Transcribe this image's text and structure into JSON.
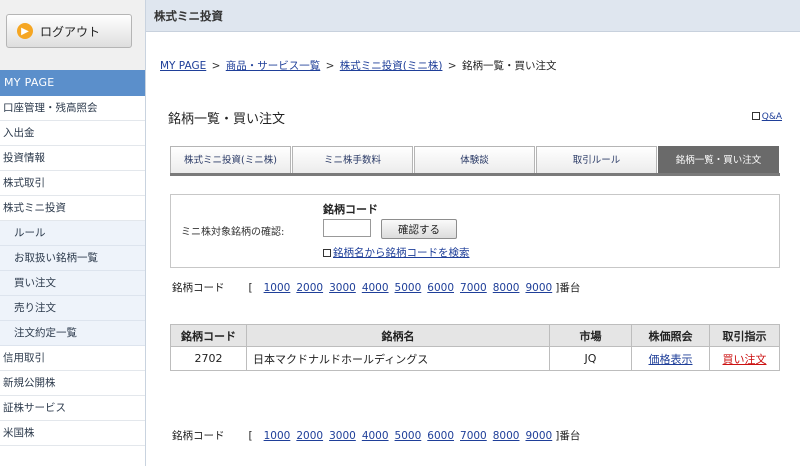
{
  "sidebar": {
    "logout_label": "ログアウト",
    "mypage_label": "MY PAGE",
    "items": [
      {
        "label": "口座管理・残高照会",
        "sub": false
      },
      {
        "label": "入出金",
        "sub": false
      },
      {
        "label": "投資情報",
        "sub": false
      },
      {
        "label": "株式取引",
        "sub": false
      },
      {
        "label": "株式ミニ投資",
        "sub": false
      },
      {
        "label": "ルール",
        "sub": true
      },
      {
        "label": "お取扱い銘柄一覧",
        "sub": true
      },
      {
        "label": "買い注文",
        "sub": true
      },
      {
        "label": "売り注文",
        "sub": true
      },
      {
        "label": "注文約定一覧",
        "sub": true
      },
      {
        "label": "信用取引",
        "sub": false
      },
      {
        "label": "新規公開株",
        "sub": false
      },
      {
        "label": "証株サービス",
        "sub": false
      },
      {
        "label": "米国株",
        "sub": false
      }
    ]
  },
  "header": {
    "title": "株式ミニ投資"
  },
  "breadcrumb": {
    "items": [
      "MY PAGE",
      "商品・サービス一覧",
      "株式ミニ投資(ミニ株)"
    ],
    "current": "銘柄一覧・買い注文",
    "separator": ">"
  },
  "page": {
    "title": "銘柄一覧・買い注文",
    "qa_label": "Q&A"
  },
  "tabs": [
    {
      "label": "株式ミニ投資(ミニ株)",
      "active": false
    },
    {
      "label": "ミニ株手数料",
      "active": false
    },
    {
      "label": "体験談",
      "active": false
    },
    {
      "label": "取引ルール",
      "active": false
    },
    {
      "label": "銘柄一覧・買い注文",
      "active": true
    }
  ],
  "search": {
    "code_label": "銘柄コード",
    "check_label": "ミニ株対象銘柄の確認:",
    "input_value": "",
    "confirm_label": "確認する",
    "search_link": "銘柄名から銘柄コードを検索"
  },
  "code_nav": {
    "label": "銘柄コード",
    "open_bracket": "[",
    "close_suffix": "]番台",
    "ranges": [
      "1000",
      "2000",
      "3000",
      "4000",
      "5000",
      "6000",
      "7000",
      "8000",
      "9000"
    ]
  },
  "table": {
    "headers": [
      "銘柄コード",
      "銘柄名",
      "市場",
      "株価照会",
      "取引指示"
    ],
    "rows": [
      {
        "code": "2702",
        "name": "日本マクドナルドホールディングス",
        "market": "JQ",
        "price_link": "価格表示",
        "trade_link": "買い注文"
      }
    ]
  },
  "colors": {
    "accent": "#5b8fcb",
    "active_tab": "#6a6a6a",
    "link": "#1f3f99",
    "buy_link": "#cc1111"
  },
  "icons": {
    "logout": "arrow-right-circle-icon",
    "qa": "square-icon",
    "search": "square-icon"
  }
}
